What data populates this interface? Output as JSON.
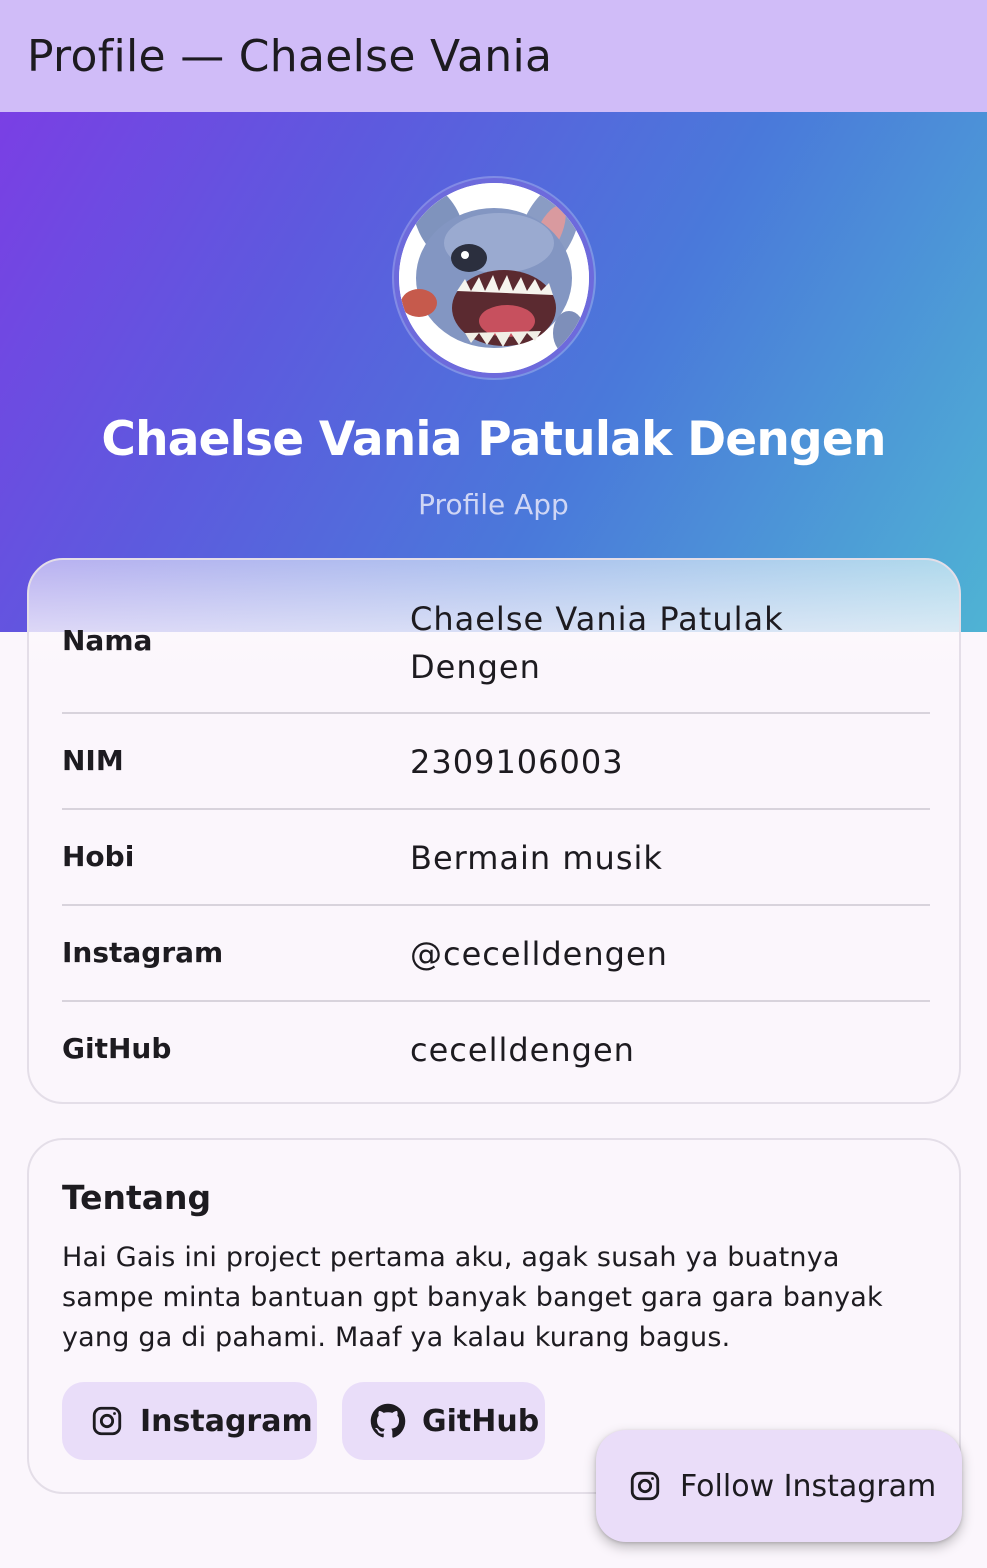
{
  "appbar": {
    "title": "Profile — Chaelse Vania"
  },
  "header": {
    "name": "Chaelse Vania Patulak Dengen",
    "subtitle": "Profile App",
    "avatar_icon": "stitch-avatar-icon",
    "gradient": [
      "#7a3fe4",
      "#4a79da",
      "#4fb3d4"
    ]
  },
  "info": {
    "rows": [
      {
        "label": "Nama",
        "value": "Chaelse Vania Patulak Dengen"
      },
      {
        "label": "NIM",
        "value": "2309106003"
      },
      {
        "label": "Hobi",
        "value": "Bermain musik"
      },
      {
        "label": "Instagram",
        "value": "@cecelldengen"
      },
      {
        "label": "GitHub",
        "value": "cecelldengen"
      }
    ]
  },
  "about": {
    "title": "Tentang",
    "text": "Hai Gais ini project pertama aku, agak susah ya buatnya sampe minta bantuan gpt banyak banget gara gara banyak yang ga di pahami. Maaf ya kalau kurang bagus.",
    "buttons": [
      {
        "label": "Instagram",
        "icon": "instagram-icon"
      },
      {
        "label": "GitHub",
        "icon": "github-icon"
      }
    ]
  },
  "fab": {
    "label": "Follow Instagram",
    "icon": "instagram-icon"
  },
  "colors": {
    "appbar": "#d0bcf8",
    "button_bg": "#e9ddf9",
    "background": "#fbf6fc"
  }
}
